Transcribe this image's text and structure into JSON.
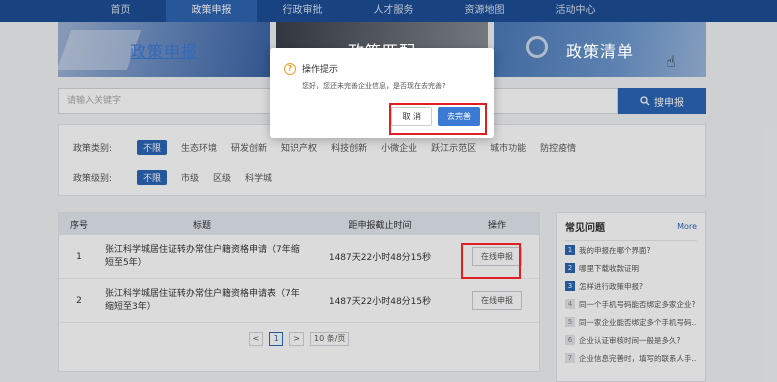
{
  "nav": [
    "首页",
    "政策申报",
    "行政审批",
    "人才服务",
    "资源地图",
    "活动中心"
  ],
  "banners": [
    "政策申报",
    "政策匹配",
    "政策清单"
  ],
  "search": {
    "placeholder": "请输入关键字",
    "button": "搜申报"
  },
  "filters": {
    "category": {
      "label": "政策类别:",
      "options": [
        "不限",
        "生态环境",
        "研发创新",
        "知识产权",
        "科技创新",
        "小微企业",
        "跃江示范区",
        "城市功能",
        "防控疫情"
      ]
    },
    "level": {
      "label": "政策级别:",
      "options": [
        "不限",
        "市级",
        "区级",
        "科学城"
      ]
    }
  },
  "table": {
    "headers": [
      "序号",
      "标题",
      "距申报截止时间",
      "操作"
    ],
    "rows": [
      {
        "no": "1",
        "title": "张江科学城居住证转办常住户籍资格申请（7年缩短至5年）",
        "time": "1487天22小时48分15秒",
        "op": "在线申报"
      },
      {
        "no": "2",
        "title": "张江科学城居住证转办常住户籍资格申请表（7年缩短至3年）",
        "time": "1487天22小时48分15秒",
        "op": "在线申报"
      }
    ],
    "pager": {
      "prev": "<",
      "current": "1",
      "next": ">",
      "size": "10 条/页"
    }
  },
  "faq": {
    "title": "常见问题",
    "more": "More",
    "items": [
      {
        "no": "1",
        "text": "我的申报在哪个界面?"
      },
      {
        "no": "2",
        "text": "哪里下载收款证明"
      },
      {
        "no": "3",
        "text": "怎样进行政策申报?"
      },
      {
        "no": "4",
        "text": "同一个手机号码能否绑定多家企业?"
      },
      {
        "no": "5",
        "text": "同一家企业能否绑定多个手机号码..."
      },
      {
        "no": "6",
        "text": "企业认证审核时间一般是多久?"
      },
      {
        "no": "7",
        "text": "企业信息完善时，填写的联系人手..."
      }
    ]
  },
  "modal": {
    "title": "操作提示",
    "message": "您好，您还未完善企业信息，是否现在去完善?",
    "cancel": "取 消",
    "confirm": "去完善"
  }
}
